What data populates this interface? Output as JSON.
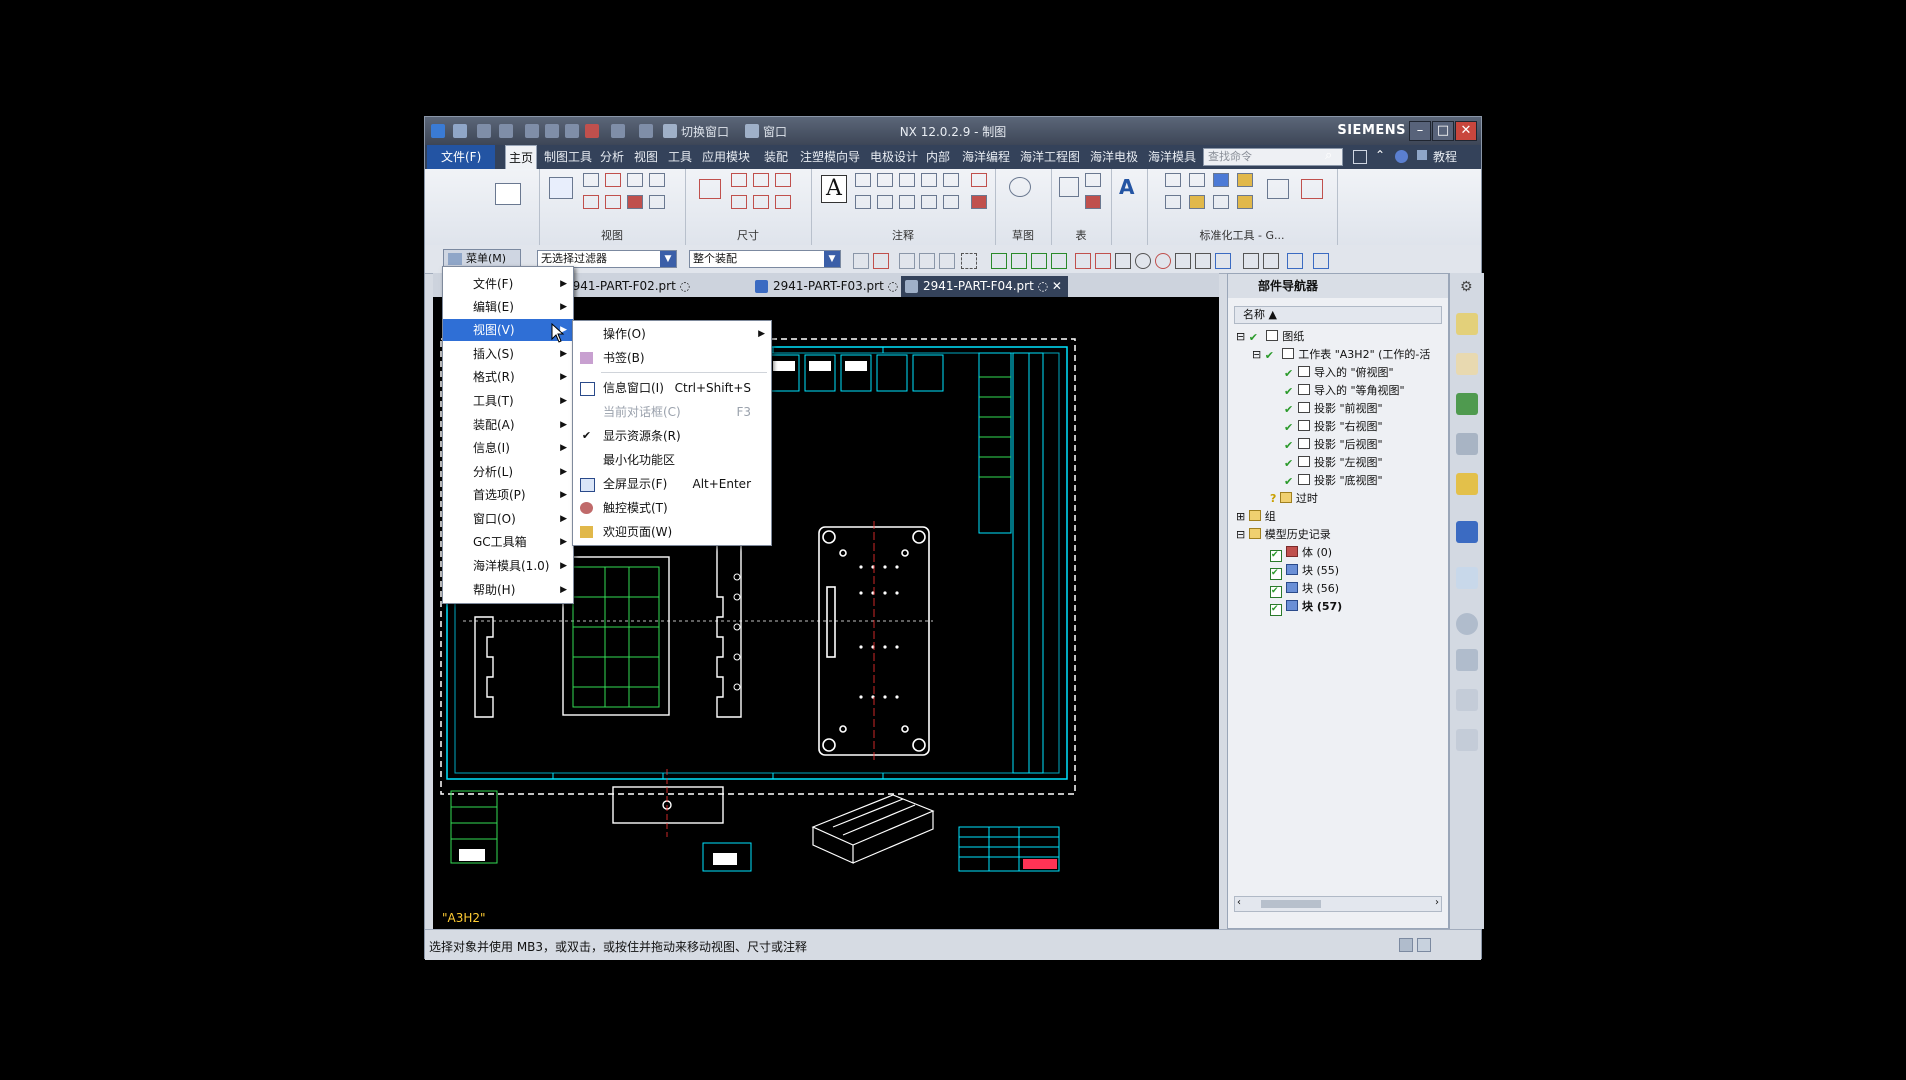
{
  "window": {
    "title": "NX 12.0.2.9 - 制图",
    "brand": "SIEMENS",
    "quick_access": {
      "switch_window": "切换窗口",
      "window": "窗口"
    }
  },
  "ribbon_tabs": [
    {
      "label": "文件(F)"
    },
    {
      "label": "主页"
    },
    {
      "label": "制图工具"
    },
    {
      "label": "分析"
    },
    {
      "label": "视图"
    },
    {
      "label": "工具"
    },
    {
      "label": "应用模块"
    },
    {
      "label": "装配"
    },
    {
      "label": "注塑模向导"
    },
    {
      "label": "电极设计"
    },
    {
      "label": "内部"
    },
    {
      "label": "海洋编程"
    },
    {
      "label": "海洋工程图"
    },
    {
      "label": "海洋电极"
    },
    {
      "label": "海洋模具"
    }
  ],
  "command_search": {
    "placeholder": "查找命令"
  },
  "tutorial_label": "教程",
  "ribbon_groups": [
    {
      "label": "视图"
    },
    {
      "label": "尺寸"
    },
    {
      "label": "注释"
    },
    {
      "label": "草图"
    },
    {
      "label": "表"
    },
    {
      "label": "标准化工具 - G..."
    }
  ],
  "selection_bar": {
    "menu_button": "菜单(M)",
    "filter": "无选择过滤器",
    "scope": "整个装配"
  },
  "doc_tabs": [
    {
      "label": "2941-PART-F02.prt"
    },
    {
      "label": "2941-PART-F03.prt"
    },
    {
      "label": "2941-PART-F04.prt"
    }
  ],
  "main_menu": {
    "items": [
      {
        "label": "文件(F)"
      },
      {
        "label": "编辑(E)"
      },
      {
        "label": "视图(V)"
      },
      {
        "label": "插入(S)"
      },
      {
        "label": "格式(R)"
      },
      {
        "label": "工具(T)"
      },
      {
        "label": "装配(A)"
      },
      {
        "label": "信息(I)"
      },
      {
        "label": "分析(L)"
      },
      {
        "label": "首选项(P)"
      },
      {
        "label": "窗口(O)"
      },
      {
        "label": "GC工具箱"
      },
      {
        "label": "海洋模具(1.0)"
      },
      {
        "label": "帮助(H)"
      }
    ]
  },
  "view_submenu": {
    "items": [
      {
        "label": "操作(O)",
        "shortcut": ""
      },
      {
        "label": "书签(B)",
        "shortcut": ""
      },
      {
        "label": "信息窗口(I)",
        "shortcut": "Ctrl+Shift+S"
      },
      {
        "label": "当前对话框(C)",
        "shortcut": "F3"
      },
      {
        "label": "显示资源条(R)",
        "shortcut": ""
      },
      {
        "label": "最小化功能区",
        "shortcut": ""
      },
      {
        "label": "全屏显示(F)",
        "shortcut": "Alt+Enter"
      },
      {
        "label": "触控模式(T)",
        "shortcut": ""
      },
      {
        "label": "欢迎页面(W)",
        "shortcut": ""
      }
    ]
  },
  "navigator": {
    "title": "部件导航器",
    "column": "名称",
    "nodes": [
      {
        "label": "图纸"
      },
      {
        "label": "工作表 \"A3H2\" (工作的-活"
      },
      {
        "label": "导入的 \"俯视图\""
      },
      {
        "label": "导入的 \"等角视图\""
      },
      {
        "label": "投影 \"前视图\""
      },
      {
        "label": "投影 \"右视图\""
      },
      {
        "label": "投影 \"后视图\""
      },
      {
        "label": "投影 \"左视图\""
      },
      {
        "label": "投影 \"底视图\""
      },
      {
        "label": "过时"
      },
      {
        "label": "组"
      },
      {
        "label": "模型历史记录"
      },
      {
        "label": "体 (0)"
      },
      {
        "label": "块 (55)"
      },
      {
        "label": "块 (56)"
      },
      {
        "label": "块 (57)"
      }
    ]
  },
  "drawing": {
    "sheet_label": "\"A3H2\""
  },
  "status": {
    "message": "选择对象并使用 MB3，或双击，或按住并拖动来移动视图、尺寸或注释"
  },
  "colors": {
    "accent": "#2f6fd6",
    "titlebar": "#3d4657",
    "tab_bar": "#34425a",
    "drawing_bg": "#000000",
    "border_line": "#00ffff"
  }
}
